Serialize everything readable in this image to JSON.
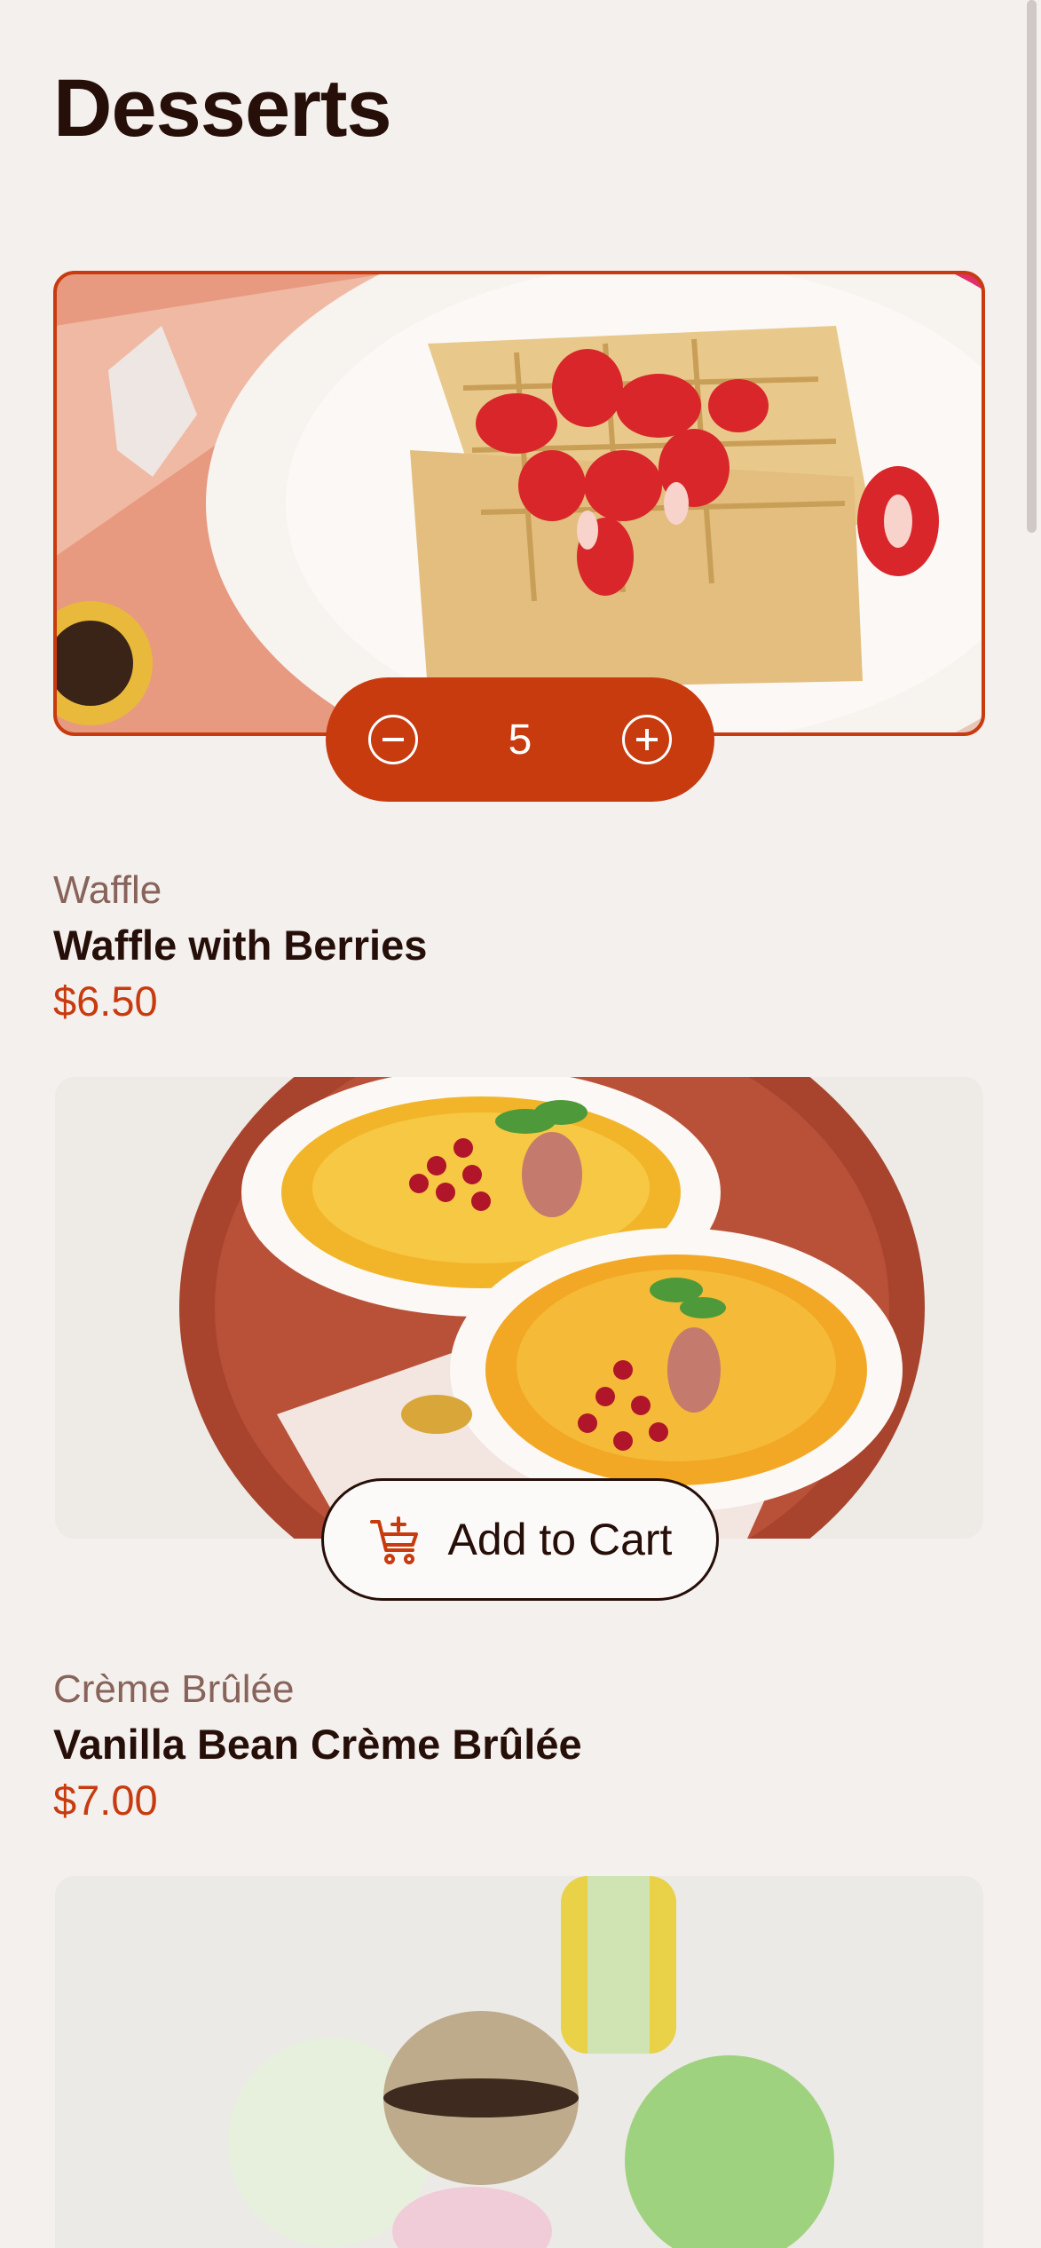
{
  "page": {
    "title": "Desserts"
  },
  "products": [
    {
      "category": "Waffle",
      "name": "Waffle with Berries",
      "price": "$6.50",
      "quantity": "5",
      "image": "waffle-photo"
    },
    {
      "category": "Crème Brûlée",
      "name": "Vanilla Bean Crème Brûlée",
      "price": "$7.00",
      "add_label": "Add to Cart",
      "image": "creme-brulee-photo"
    },
    {
      "image": "macaron-photo"
    }
  ],
  "colors": {
    "accent": "#C73B0F",
    "text": "#260F08",
    "muted": "#87635A",
    "background": "#F4F0EE"
  }
}
